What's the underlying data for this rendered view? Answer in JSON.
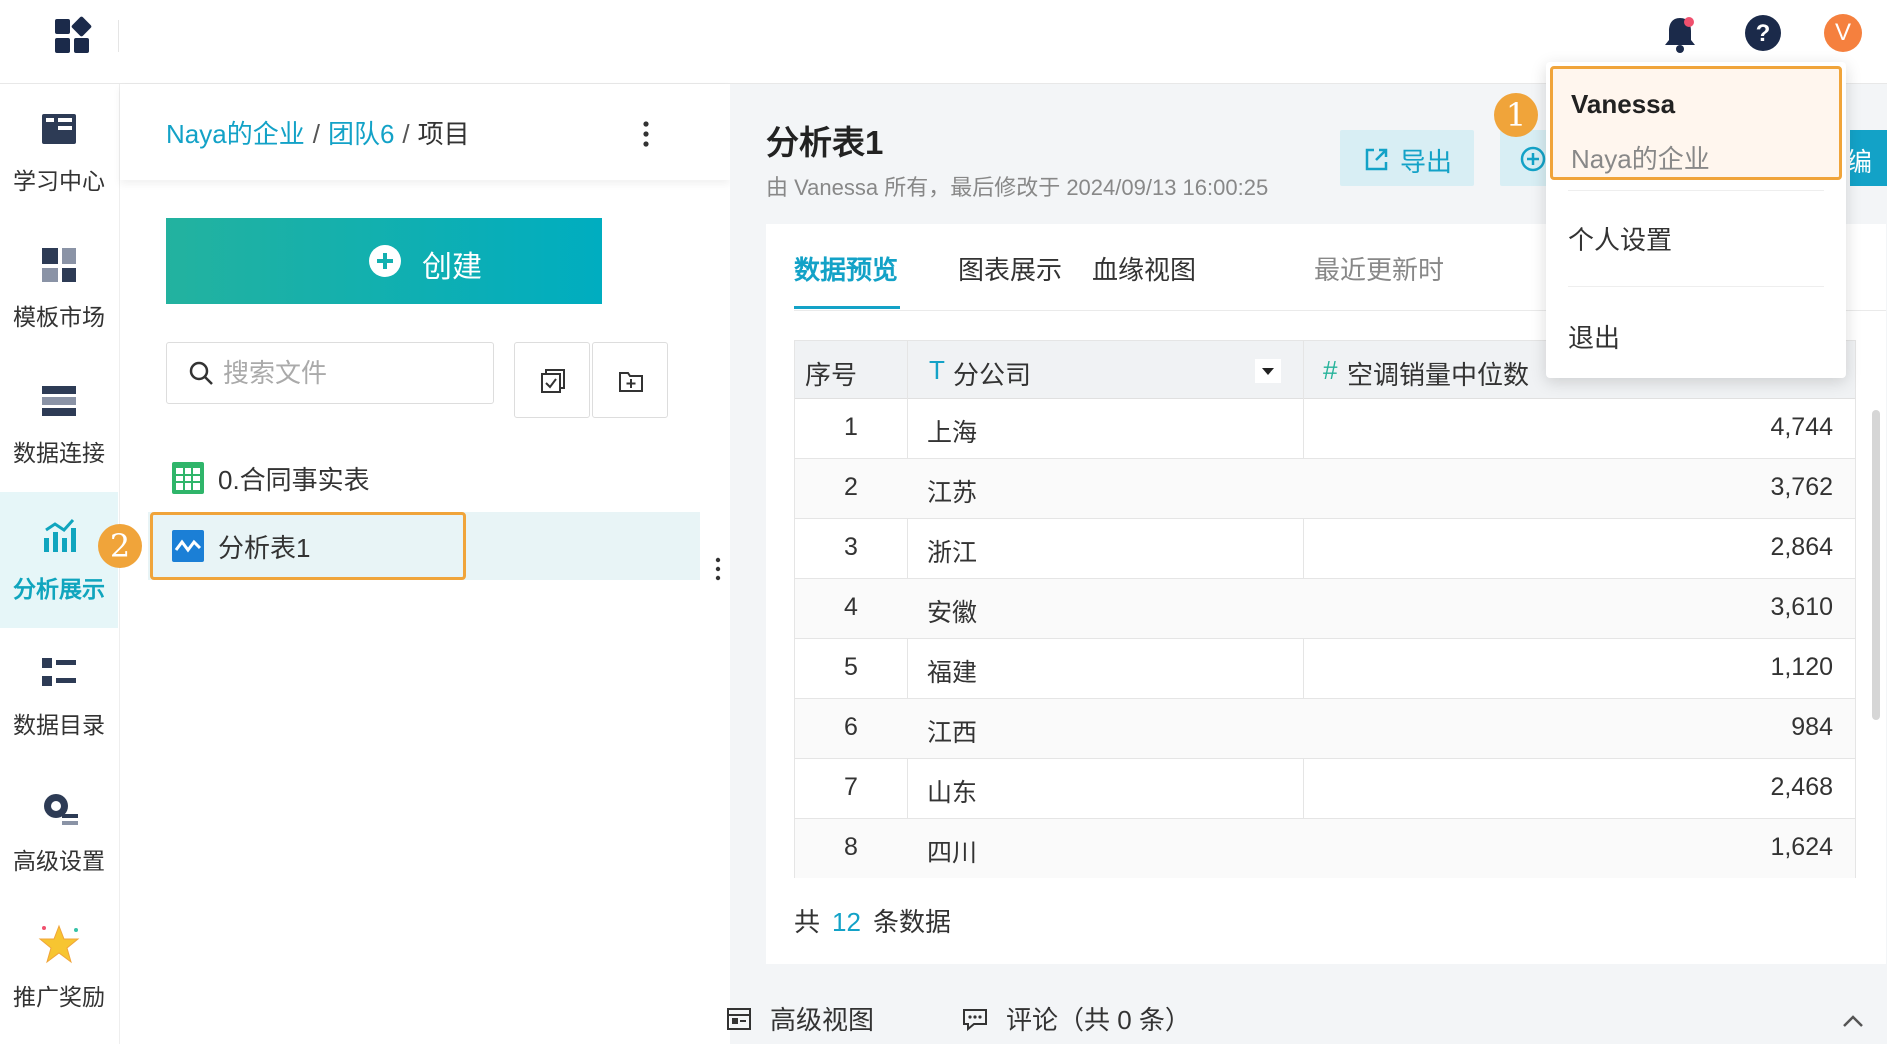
{
  "topbar": {
    "app_icon": "app-grid-icon",
    "notification_icon": "bell-icon",
    "help_icon": "help-icon",
    "avatar_letter": "V",
    "avatar_color": "#f5803e"
  },
  "rail": {
    "items": [
      {
        "label": "学习中心",
        "icon": "learning-icon"
      },
      {
        "label": "模板市场",
        "icon": "template-icon"
      },
      {
        "label": "数据连接",
        "icon": "data-connect-icon"
      },
      {
        "label": "分析展示",
        "icon": "analysis-icon",
        "active": true
      },
      {
        "label": "数据目录",
        "icon": "catalog-icon"
      },
      {
        "label": "高级设置",
        "icon": "settings-icon"
      },
      {
        "label": "推广奖励",
        "icon": "star-icon"
      }
    ]
  },
  "filepanel": {
    "breadcrumb": {
      "org": "Naya的企业",
      "team": "团队6",
      "current": "项目",
      "sep": "/"
    },
    "create_label": "创建",
    "search_placeholder": "搜索文件",
    "files": [
      {
        "name": "0.合同事实表",
        "icon": "table-icon"
      },
      {
        "name": "分析表1",
        "icon": "analysis-sheet-icon",
        "selected": true
      }
    ],
    "badge_2": "2"
  },
  "main": {
    "title": "分析表1",
    "subtitle": "由 Vanessa 所有，最后修改于 2024/09/13 16:00:25",
    "export_label": "导出",
    "edge_label": "编",
    "tabs": [
      "数据预览",
      "图表展示",
      "血缘视图"
    ],
    "recent_label": "最近更新时",
    "table": {
      "headers": {
        "index": "序号",
        "company": "分公司",
        "value": "空调销量中位数"
      },
      "company_type_icon": "T",
      "value_type_icon": "#",
      "rows": [
        {
          "index": "1",
          "company": "上海",
          "value": "4,744"
        },
        {
          "index": "2",
          "company": "江苏",
          "value": "3,762"
        },
        {
          "index": "3",
          "company": "浙江",
          "value": "2,864"
        },
        {
          "index": "4",
          "company": "安徽",
          "value": "3,610"
        },
        {
          "index": "5",
          "company": "福建",
          "value": "1,120"
        },
        {
          "index": "6",
          "company": "江西",
          "value": "984"
        },
        {
          "index": "7",
          "company": "山东",
          "value": "2,468"
        },
        {
          "index": "8",
          "company": "四川",
          "value": "1,624"
        }
      ]
    },
    "total": {
      "prefix": "共",
      "count": "12",
      "suffix": "条数据"
    },
    "bottom": {
      "advanced_view": "高级视图",
      "comments": "评论（共 0 条）"
    }
  },
  "dropdown": {
    "user_name": "Vanessa",
    "org_name": "Naya的企业",
    "items": [
      "个人设置",
      "退出"
    ],
    "badge_1": "1"
  },
  "colors": {
    "accent": "#13a2c7",
    "highlight": "#f0a43a",
    "create_gradient": [
      "#23b29f",
      "#00adc0"
    ]
  }
}
